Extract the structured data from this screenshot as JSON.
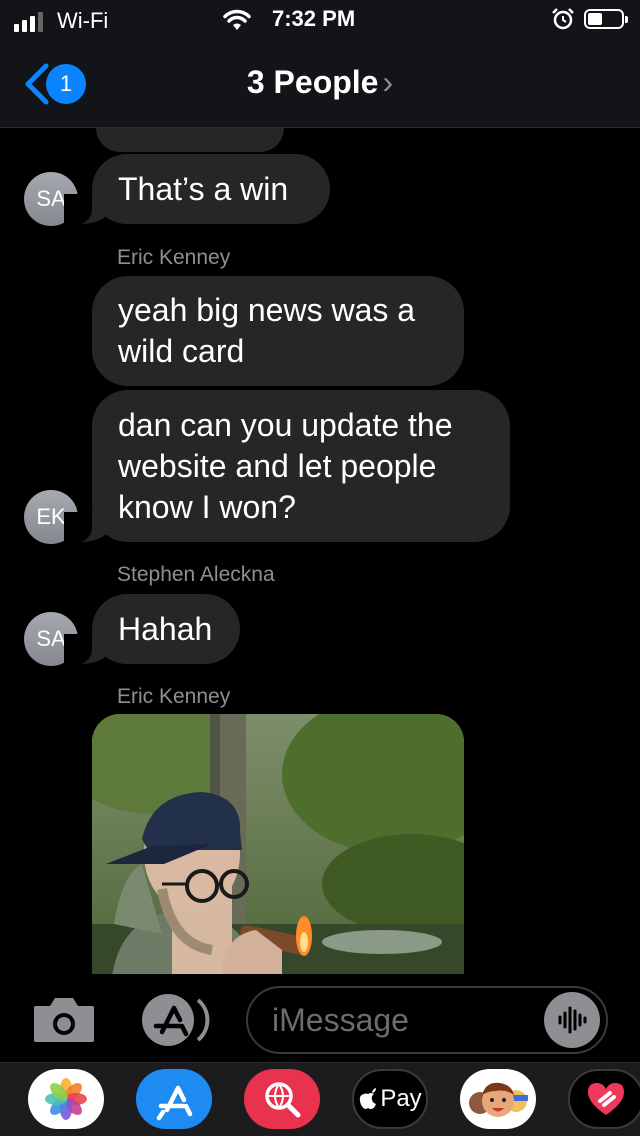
{
  "status_bar": {
    "carrier": "Wi-Fi",
    "time": "7:32 PM"
  },
  "nav": {
    "back_badge": "1",
    "title": "3 People",
    "title_chevron": "›"
  },
  "messages": [
    {
      "text": "That’s a win",
      "avatar": "SA"
    },
    {
      "sender": "Eric Kenney",
      "text": "yeah big news was a wild card"
    },
    {
      "text": "dan can you update the website and let people know I won?",
      "avatar": "EK"
    },
    {
      "sender": "Stephen Aleckna",
      "text": "Hahah",
      "avatar": "SA"
    },
    {
      "sender": "Eric Kenney",
      "attachment": "photo"
    }
  ],
  "input": {
    "placeholder": "iMessage"
  },
  "drawer": {
    "apple_pay_label": "Pay"
  },
  "colors": {
    "accent": "#0a84ff",
    "bubble": "#262628",
    "background": "#000000",
    "secondary_text": "#8e8e93"
  }
}
